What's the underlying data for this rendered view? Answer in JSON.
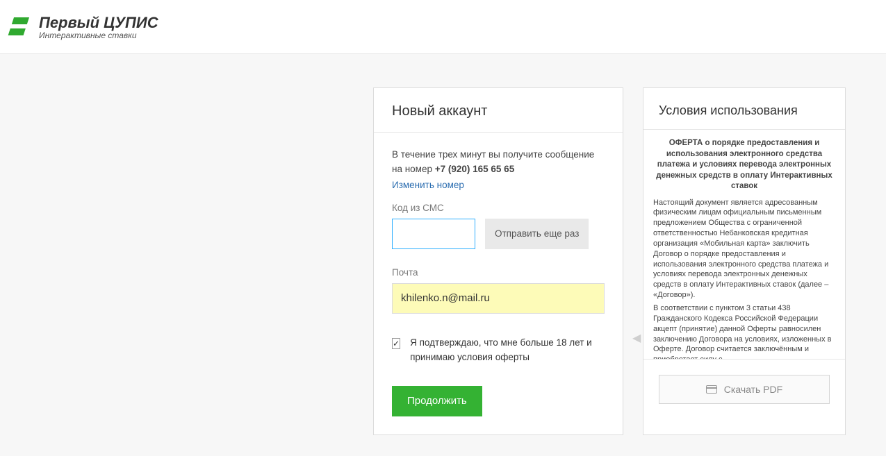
{
  "brand": {
    "name": "Первый ЦУПИС",
    "tagline": "Интерактивные ставки"
  },
  "form": {
    "header": "Новый аккаунт",
    "sms_notice_prefix": "В течение трех минут вы получите сообщение на номер ",
    "phone": "+7 (920) 165 65 65",
    "change_number": "Изменить номер",
    "sms_label": "Код из СМС",
    "sms_value": "",
    "resend_label": "Отправить еще раз",
    "email_label": "Почта",
    "email_value": "khilenko.n@mail.ru",
    "confirm_checked": true,
    "confirm_text": "Я подтверждаю, что мне больше 18 лет и принимаю условия оферты",
    "continue": "Продолжить"
  },
  "terms": {
    "header": "Условия использования",
    "title": "ОФЕРТА о порядке предоставления и использования электронного средства платежа и условиях перевода электронных денежных средств в оплату Интерактивных ставок",
    "body_p1": "Настоящий документ является адресованным физическим лицам официальным письменным предложением Общества с ограниченной ответственностью Небанковская кредитная организация «Мобильная карта» заключить Договор о порядке предоставления и использования электронного средства платежа и условиях перевода электронных денежных средств в оплату Интерактивных ставок (далее – «Договор»).",
    "body_p2": "В соответствии с пунктом 3 статьи 438 Гражданского Кодекса Российской Федерации акцепт (принятие) данной Оферты равносилен заключению Договора на условиях, изложенных в Оферте. Договор считается заключённым и приобретает силу с",
    "pdf_label": "Скачать PDF"
  }
}
